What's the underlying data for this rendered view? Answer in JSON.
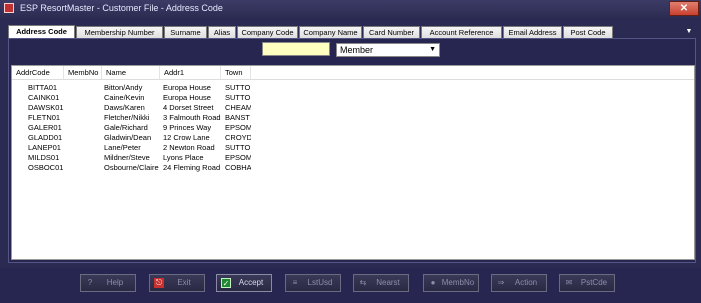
{
  "window": {
    "title": "ESP ResortMaster - Customer File - Address Code",
    "close_label": "✕"
  },
  "tabs": [
    {
      "label": "Address Code"
    },
    {
      "label": "Membership Number"
    },
    {
      "label": "Surname"
    },
    {
      "label": "Alias"
    },
    {
      "label": "Company Code"
    },
    {
      "label": "Company Name"
    },
    {
      "label": "Card Number"
    },
    {
      "label": "Account Reference"
    },
    {
      "label": "Email Address"
    },
    {
      "label": "Post Code"
    }
  ],
  "search": {
    "value": ""
  },
  "filter": {
    "selected": "Member"
  },
  "table": {
    "columns": [
      "AddrCode",
      "MembNo",
      "Name",
      "Addr1",
      "Town"
    ],
    "rows": [
      [
        "BITTA01",
        "",
        "Bitton/Andy",
        "Europa House",
        "SUTTO"
      ],
      [
        "CAINK01",
        "",
        "Caine/Kevin",
        "Europa House",
        "SUTTO"
      ],
      [
        "DAWSK01",
        "",
        "Daws/Karen",
        "4 Dorset Street",
        "CHEAM"
      ],
      [
        "FLETN01",
        "",
        "Fletcher/Nikki",
        "3 Falmouth Road",
        "BANST"
      ],
      [
        "GALER01",
        "",
        "Gale/Richard",
        "9 Princes Way",
        "EPSOM"
      ],
      [
        "GLADD01",
        "",
        "Gladwin/Dean",
        "12 Crow Lane",
        "CROYD"
      ],
      [
        "LANEP01",
        "",
        "Lane/Peter",
        "2 Newton Road",
        "SUTTO"
      ],
      [
        "MILDS01",
        "",
        "Mildner/Steve",
        "Lyons Place",
        "EPSOM"
      ],
      [
        "OSBOC01",
        "",
        "Osbourne/Claire",
        "24 Fleming Road",
        "COBHA"
      ]
    ]
  },
  "buttons": [
    {
      "label": "Help",
      "icon": "help-icon"
    },
    {
      "label": "Exit",
      "icon": "exit-icon"
    },
    {
      "label": "Accept",
      "icon": "check-icon"
    },
    {
      "label": "LstUsd",
      "icon": "list-icon"
    },
    {
      "label": "Nearst",
      "icon": "nearest-icon"
    },
    {
      "label": "MembNo",
      "icon": "member-icon"
    },
    {
      "label": "Action",
      "icon": "action-icon"
    },
    {
      "label": "PstCde",
      "icon": "postcode-icon"
    }
  ]
}
